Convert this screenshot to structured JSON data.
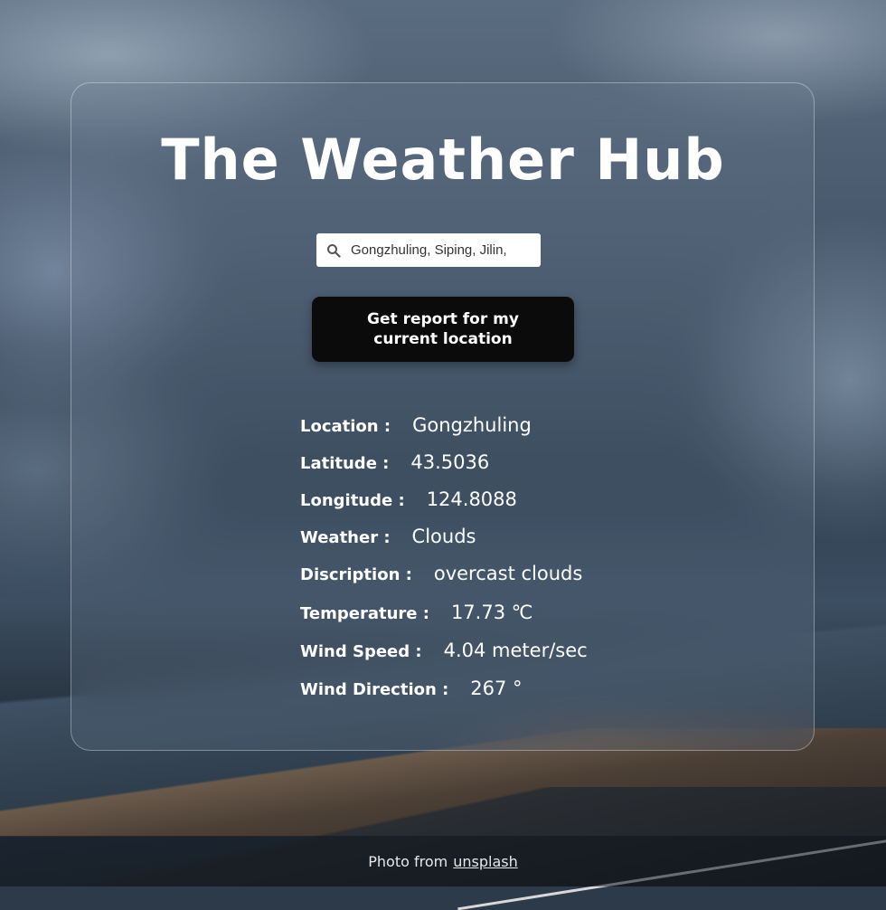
{
  "app": {
    "title": "The Weather Hub"
  },
  "search": {
    "value": "Gongzhuling, Siping, Jilin,",
    "icon": "search-icon"
  },
  "location_button": {
    "label": "Get report for my current location"
  },
  "report": [
    {
      "label": "Location :",
      "value": "Gongzhuling"
    },
    {
      "label": "Latitude :",
      "value": "43.5036"
    },
    {
      "label": "Longitude :",
      "value": "124.8088"
    },
    {
      "label": "Weather :",
      "value": "Clouds"
    },
    {
      "label": "Discription :",
      "value": "overcast clouds"
    },
    {
      "label": "Temperature :",
      "value": "17.73 ℃"
    },
    {
      "label": "Wind Speed :",
      "value": "4.04 meter/sec"
    },
    {
      "label": "Wind Direction :",
      "value": "267 °"
    }
  ],
  "footer": {
    "text": "Photo from",
    "link_label": "unsplash"
  },
  "colors": {
    "button_bg": "#0b0b0b",
    "text": "#ffffff"
  }
}
